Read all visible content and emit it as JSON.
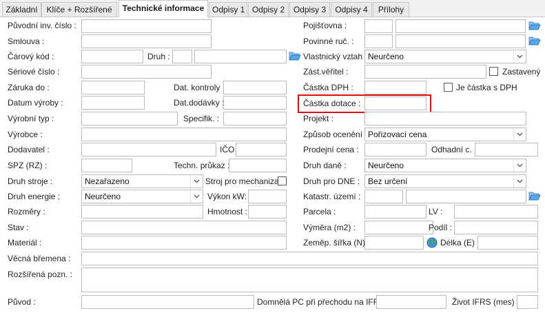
{
  "tabs": [
    {
      "label": "Základní"
    },
    {
      "label": "Klíče + Rozšířené"
    },
    {
      "label": "Technické informace"
    },
    {
      "label": "Odpisy 1"
    },
    {
      "label": "Odpisy 2"
    },
    {
      "label": "Odpisy 3"
    },
    {
      "label": "Odpisy 4"
    },
    {
      "label": "Přílohy"
    }
  ],
  "active_tab": "Technické informace",
  "left": {
    "puvodni_inv_cislo": "Původní inv. číslo :",
    "smlouva": "Smlouva :",
    "carovy_kod": "Čárový kód :",
    "druh": "Druh :",
    "seriove_cislo": "Sériové číslo :",
    "zaruka_do": "Záruka do :",
    "dat_kontroly": "Dat. kontroly :",
    "datum_vyroby": "Datum výroby :",
    "dat_dodavky": "Dat.dodávky :",
    "vyrobni_typ": "Výrobní typ :",
    "specifik": "Specifik. :",
    "vyrobce": "Výrobce :",
    "dodavatel": "Dodavatel :",
    "ico": "IČO",
    "spz": "SPZ (RZ) :",
    "techn_prukaz": "Techn. průkaz :",
    "druh_stroje": "Druh stroje :",
    "druh_stroje_value": "Nezařazeno",
    "stroj_pro_mechanizaci": "Stroj pro mechanizaci",
    "druh_energie": "Druh energie :",
    "druh_energie_value": "Neurčeno",
    "vykon_kw": "Výkon kW:",
    "rozmery": "Rozměry :",
    "hmotnost": "Hmotnost :",
    "stav": "Stav :",
    "material": "Materiál :"
  },
  "right": {
    "pojistovna": "Pojišťovna :",
    "povinne_ruc": "Povinné ruč. :",
    "vlastnicky_vztah": "Vlastnický vztah :",
    "vlastnicky_vztah_value": "Neurčeno",
    "zast_veritel": "Zást.věřitel :",
    "zastaveny": "Zastavený",
    "castka_dph": "Částka DPH :",
    "je_castka_s_dph": "Je částka s DPH",
    "castka_dotace": "Částka dotace :",
    "projekt": "Projekt :",
    "zpusob_oceneni": "Způsob ocenění :",
    "zpusob_oceneni_value": "Pořizovací cena",
    "prodejni_cena": "Prodejní cena :",
    "odhadni_c": "Odhadní c. :",
    "druh_dane": "Druh daně :",
    "druh_dane_value": "Neurčeno",
    "druh_pro_dne": "Druh pro DNE :",
    "druh_pro_dne_value": "Bez určení",
    "katastr_uzemi": "Katastr. území :",
    "parcela": "Parcela :",
    "lv": "LV :",
    "vymera": "Výměra (m2) :",
    "podil": "Podíl :",
    "zemep_sirka": "Zeměp. šířka (N) :",
    "delka": "Délka (E) :"
  },
  "bottom": {
    "vecna_bremena": "Věcná břemena :",
    "rozsirena_pozn": "Rozšířená pozn. :",
    "puvod": "Původ :",
    "domnela_pc": "Domnělá PC při přechodu na IFRS :",
    "zivot_ifrs": "Život IFRS (mes) :"
  },
  "icons": {
    "folder": "open-folder-icon",
    "globe": "globe-icon",
    "dropdown": "chevron-down-icon"
  },
  "colors": {
    "highlight": "#e01010",
    "folder": "#3d8fd6"
  }
}
